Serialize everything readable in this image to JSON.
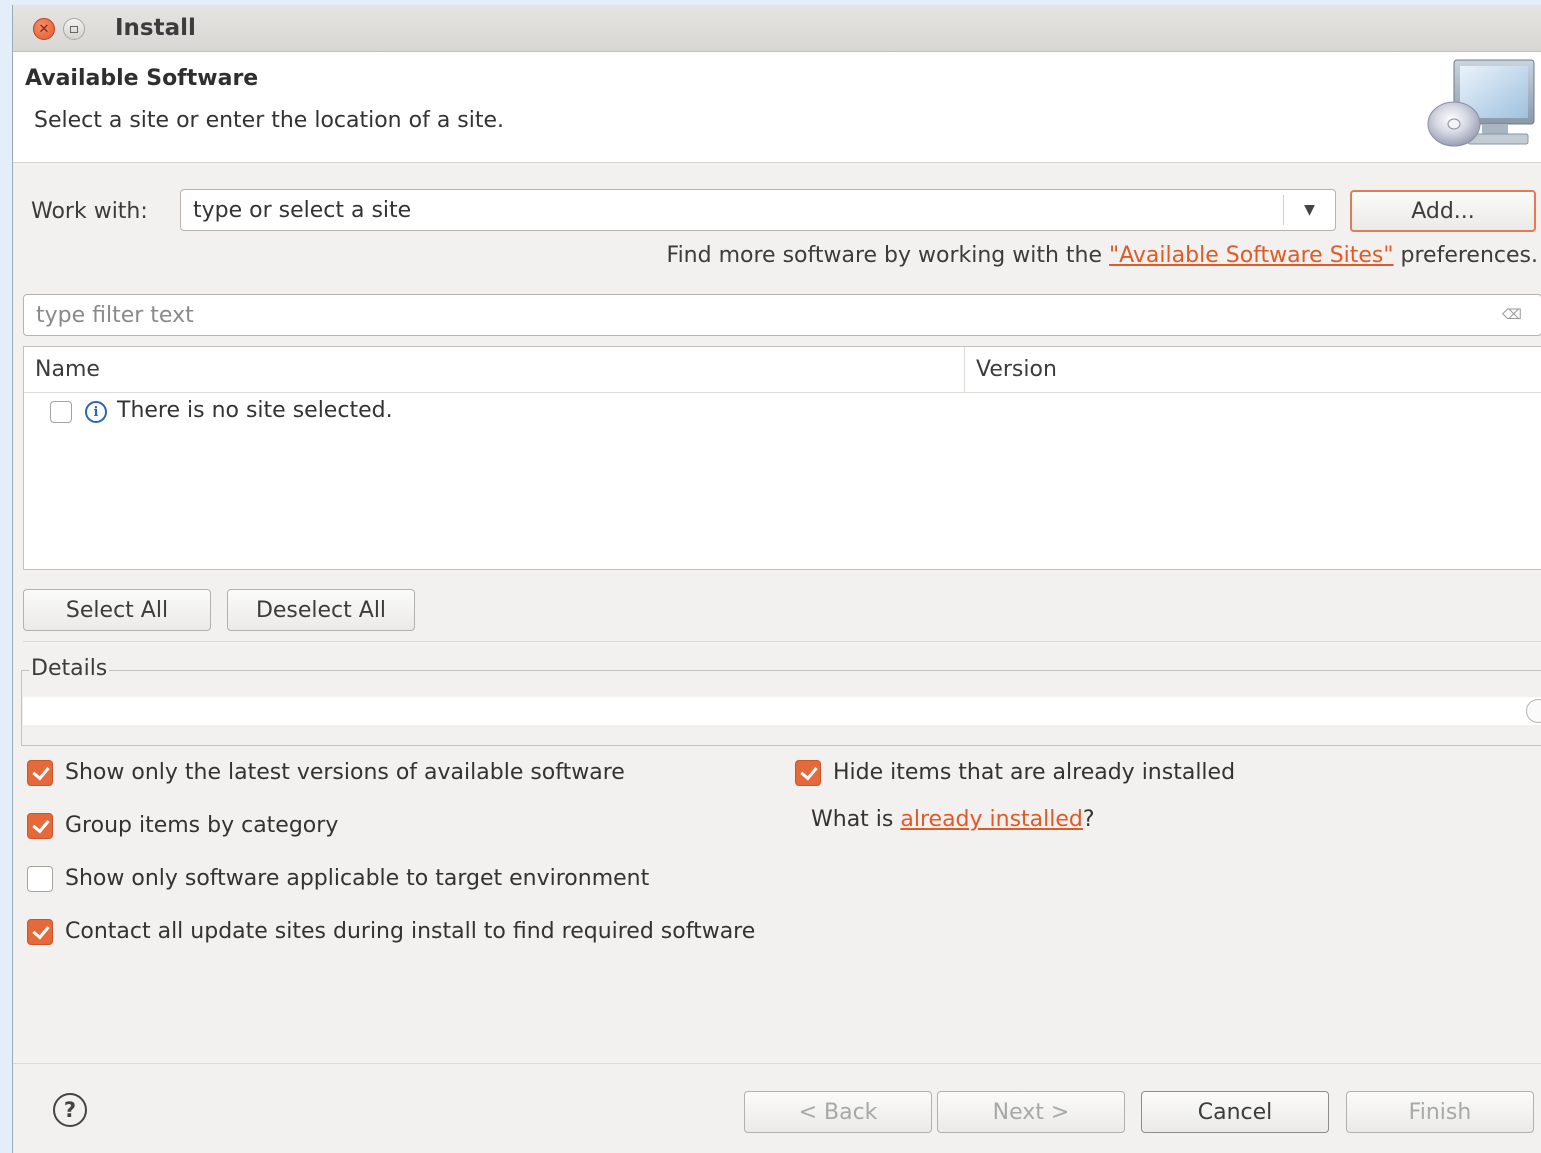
{
  "window": {
    "title": "Install"
  },
  "header": {
    "title": "Available Software",
    "description": "Select a site or enter the location of a site."
  },
  "work_with": {
    "label": "Work with:",
    "value": "type or select a site",
    "add_label": "Add..."
  },
  "find_more": {
    "prefix": "Find more software by working with the ",
    "link": "\"Available Software Sites\"",
    "suffix": " preferences."
  },
  "filter": {
    "placeholder": "type filter text"
  },
  "table": {
    "columns": [
      "Name",
      "Version"
    ],
    "rows": [
      {
        "checked": false,
        "name": "There is no site selected.",
        "version": ""
      }
    ]
  },
  "selection": {
    "select_all": "Select All",
    "deselect_all": "Deselect All"
  },
  "details": {
    "legend": "Details",
    "text": ""
  },
  "options": {
    "latest_versions": {
      "label": "Show only the latest versions of available software",
      "checked": true
    },
    "group_by_category": {
      "label": "Group items by category",
      "checked": true
    },
    "target_env": {
      "label": "Show only software applicable to target environment",
      "checked": false
    },
    "contact_sites": {
      "label": "Contact all update sites during install to find required software",
      "checked": true
    },
    "hide_installed": {
      "label": "Hide items that are already installed",
      "checked": true
    }
  },
  "already_installed": {
    "prefix": "What is ",
    "link": "already installed",
    "suffix": "?"
  },
  "footer": {
    "back": "< Back",
    "next": "Next >",
    "cancel": "Cancel",
    "finish": "Finish"
  },
  "icons": {
    "close": "close-icon",
    "maximize": "maximize-icon",
    "install_graphic": "computer-cd-icon",
    "dropdown": "chevron-down-icon",
    "clear": "clear-icon",
    "info": "info-icon",
    "help": "help-icon"
  },
  "colors": {
    "accent": "#e5693a",
    "link": "#e05a26",
    "info": "#2a67b2"
  }
}
